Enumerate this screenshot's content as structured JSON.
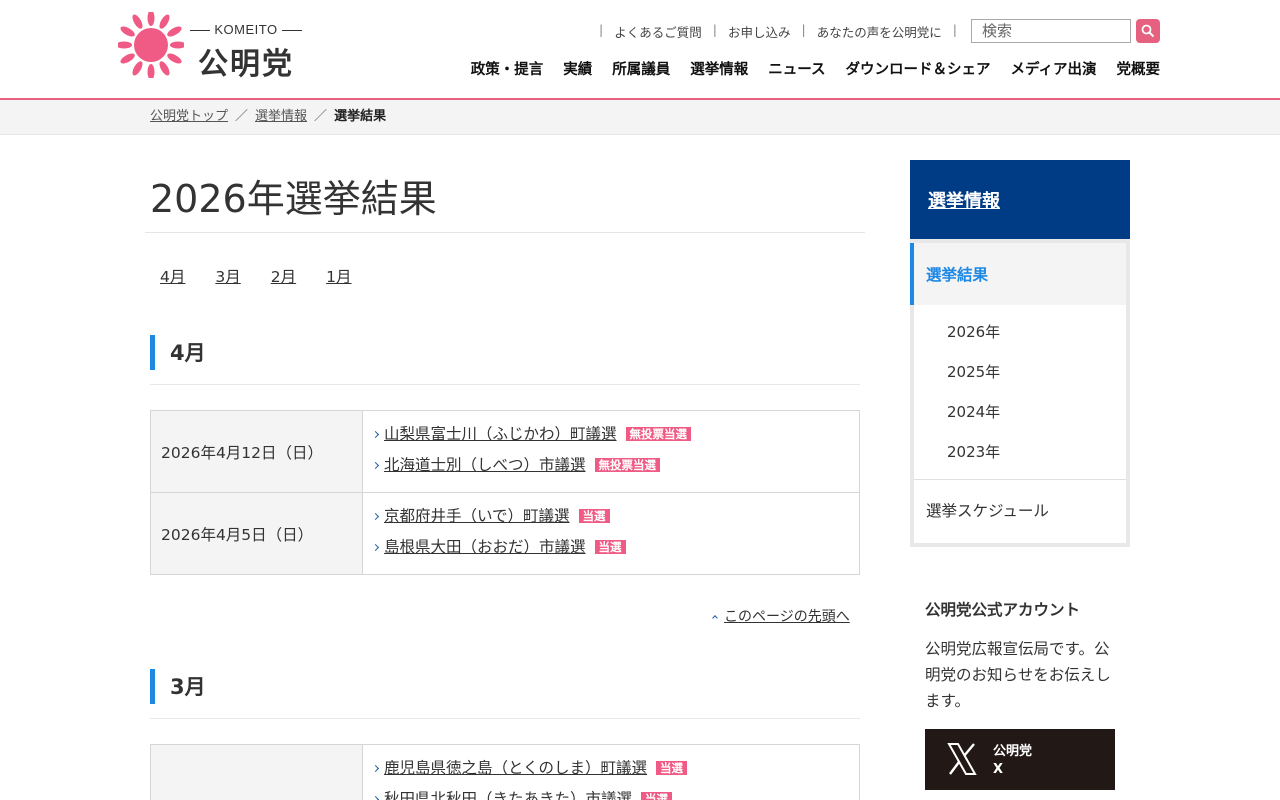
{
  "header": {
    "logo_sub": "KOMEITO",
    "logo_name": "公明党",
    "util_links": [
      "よくあるご質問",
      "お申し込み",
      "あなたの声を公明党に"
    ],
    "search_placeholder": "検索",
    "nav": [
      "政策・提言",
      "実績",
      "所属議員",
      "選挙情報",
      "ニュース",
      "ダウンロード＆シェア",
      "メディア出演",
      "党概要"
    ],
    "accent_color": "#e5617f"
  },
  "breadcrumb": {
    "items": [
      "公明党トップ",
      "選挙情報"
    ],
    "current": "選挙結果"
  },
  "main": {
    "title": "2026年選挙結果",
    "month_links": [
      "4月",
      "3月",
      "2月",
      "1月"
    ],
    "sections": [
      {
        "month": "4月",
        "rows": [
          {
            "date": "2026年4月12日（日）",
            "races": [
              {
                "name": "山梨県富士川（ふじかわ）町議選",
                "result": "無投票当選"
              },
              {
                "name": "北海道士別（しべつ）市議選",
                "result": "無投票当選"
              }
            ]
          },
          {
            "date": "2026年4月5日（日）",
            "races": [
              {
                "name": "京都府井手（いで）町議選",
                "result": "当選"
              },
              {
                "name": "島根県大田（おおだ）市議選",
                "result": "当選"
              }
            ]
          }
        ]
      },
      {
        "month": "3月",
        "rows": [
          {
            "date": "",
            "races": [
              {
                "name": "鹿児島県徳之島（とくのしま）町議選",
                "result": "当選"
              },
              {
                "name": "秋田県北秋田（きたあきた）市議選",
                "result": "当選"
              }
            ]
          }
        ]
      }
    ],
    "page_top": "このページの先頭へ"
  },
  "sidebar": {
    "heading": "選挙情報",
    "active": "選挙結果",
    "years": [
      "2026年",
      "2025年",
      "2024年",
      "2023年"
    ],
    "schedule": "選挙スケジュール",
    "account_title": "公明党公式アカウント",
    "account_desc": "公明党広報宣伝局です。公明党のお知らせをお伝えします。",
    "x_label_1": "公明党",
    "x_label_2": "X"
  }
}
